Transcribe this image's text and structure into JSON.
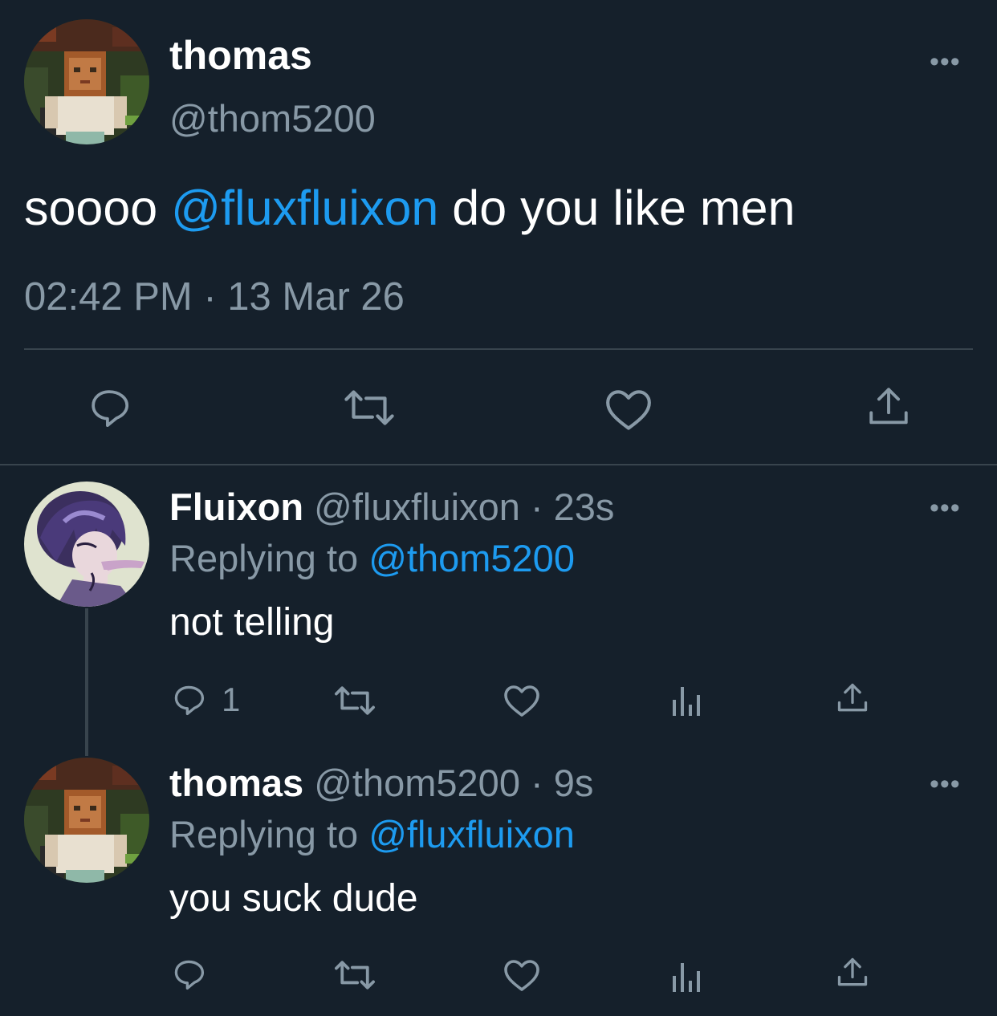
{
  "colors": {
    "background": "#15202b",
    "text": "#ffffff",
    "muted": "#8899a6",
    "accent": "#1d9bf0",
    "divider": "#38444d"
  },
  "main_tweet": {
    "display_name": "thomas",
    "handle": "@thom5200",
    "text_before": "soooo",
    "mention": "@fluxfluixon",
    "text_after": "do you like men",
    "timestamp": "02:42 PM · 13 Mar 26",
    "avatar_icon": "minecraft-skin-avatar",
    "more_icon": "ellipsis-icon",
    "actions": [
      "reply-icon",
      "retweet-icon",
      "like-icon",
      "share-icon"
    ]
  },
  "replies": [
    {
      "display_name": "Fluixon",
      "handle": "@fluxfluixon",
      "time": "· 23s",
      "replying_label": "Replying to",
      "replying_to": "@thom5200",
      "text": "not telling",
      "reply_count": "1",
      "avatar_icon": "anime-character-avatar",
      "actions": [
        "reply-icon",
        "retweet-icon",
        "like-icon",
        "analytics-icon",
        "share-icon"
      ]
    },
    {
      "display_name": "thomas",
      "handle": "@thom5200",
      "time": "· 9s",
      "replying_label": "Replying to",
      "replying_to": "@fluxfluixon",
      "text": "you suck dude",
      "reply_count": "",
      "avatar_icon": "minecraft-skin-avatar",
      "actions": [
        "reply-icon",
        "retweet-icon",
        "like-icon",
        "analytics-icon",
        "share-icon"
      ]
    }
  ]
}
